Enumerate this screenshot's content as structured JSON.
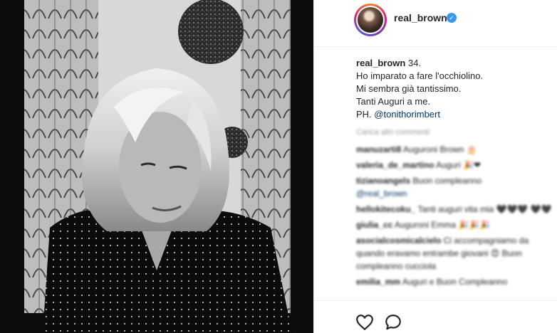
{
  "post": {
    "username": "real_brown",
    "verified_badge": "✓",
    "caption": {
      "user": "real_brown",
      "first": "34.",
      "lines": [
        "Ho imparato a fare l'occhiolino.",
        "Mi sembra già tantissimo.",
        "Tanti Auguri a me."
      ],
      "credit_prefix": "PH.",
      "credit_mention": "@tonithorimbert"
    },
    "load_more_label": "Carica altri commenti",
    "comments": [
      {
        "user": "manuzarti8",
        "text": "Auguroni Brown 🎂"
      },
      {
        "user": "valeria_de_martino",
        "text": "Auguri 🎉❤"
      },
      {
        "user": "tizianoangels",
        "text": "Buon compleanno",
        "mention": "@real_brown"
      },
      {
        "user": "hellokitecoku_",
        "text": "Tanti auguri vita mia 🖤🖤🖤 🖤🖤"
      },
      {
        "user": "giulia_cc",
        "text": "Auguroni Emma 🎉🎉🎉"
      },
      {
        "user": "asocialcosmicalcielo",
        "text": "Ci accompagniamo da quando eravamo entrambe giovani 😍 Buon compleanno cucciola"
      },
      {
        "user": "emilia_mm",
        "text": "Auguri e Buon Compleanno"
      }
    ]
  },
  "icons": {
    "like": "heart-icon",
    "comment": "comment-icon"
  },
  "colors": {
    "link": "#003569",
    "verified": "#3897f0",
    "text": "#262626",
    "muted": "#999999"
  }
}
